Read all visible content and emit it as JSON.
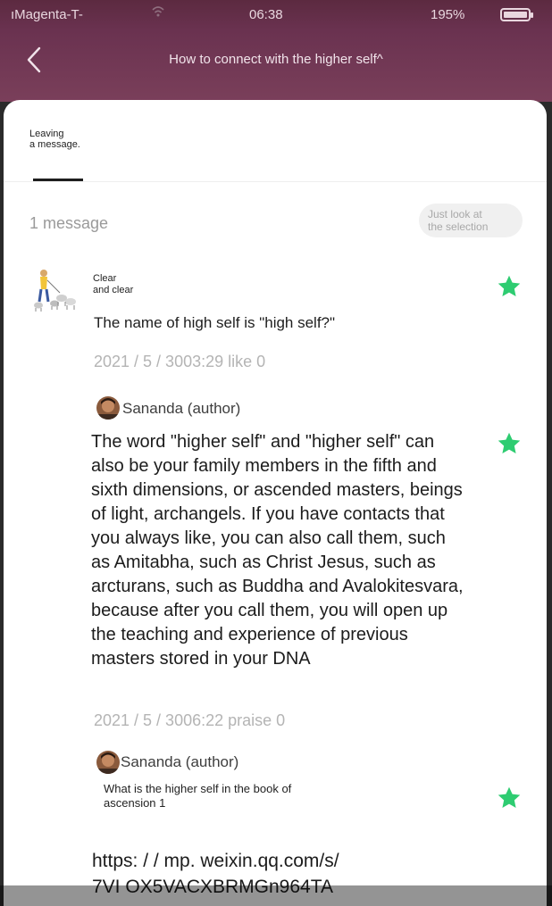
{
  "status_bar": {
    "carrier": "ıMagenta-T-",
    "time": "06:38",
    "battery": "195%"
  },
  "nav": {
    "title": "How to connect with the higher self^"
  },
  "tabs": {
    "active_label": "Leaving\na message."
  },
  "messages": {
    "count_label": "1 message",
    "filter_label": "Just look at\nthe selection"
  },
  "comment": {
    "author": "Clear\nand clear",
    "text": "The name of high self is \"high self?\"",
    "meta": "2021 / 5 / 3003:29 like 0"
  },
  "reply1": {
    "author": "Sananda (author)",
    "text": "The word \"higher self\" and \"higher self\" can also be your family members in the fifth and sixth dimensions, or ascended masters, beings of light, archangels. If you have contacts that you always like, you can also call them, such as Amitabha, such as Christ Jesus, such as arcturans, such as Buddha and Avalokitesvara, because after you call them, you will open up the teaching and experience of previous masters stored in your DNA",
    "meta": "2021 / 5 / 3006:22 praise 0"
  },
  "reply2": {
    "author": "Sananda (author)",
    "text": "What is the higher self in the book of ascension 1",
    "link": "https: / / mp. weixin.qq.com/s/\n7VI OX5VACXBRMGn964TA"
  },
  "colors": {
    "header": "#6a3250",
    "star": "#2ecc71",
    "meta_gray": "#b4b4b4"
  }
}
